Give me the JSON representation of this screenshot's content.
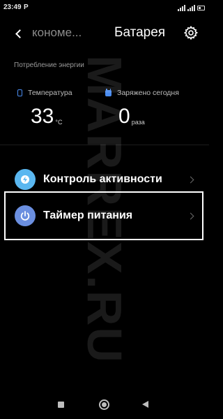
{
  "status_bar": {
    "time": "23:49",
    "carrier_icon_text": "P",
    "icons": [
      "signal-icon",
      "signal-icon",
      "battery-icon"
    ]
  },
  "header": {
    "previous_screen": "кономе...",
    "title": "Батарея"
  },
  "section": {
    "label": "Потребление энергии"
  },
  "stats": {
    "temperature": {
      "label": "Температура",
      "value": "33",
      "unit": "°C"
    },
    "charged_today": {
      "label": "Заряжено сегодня",
      "value": "0",
      "unit": "раза"
    }
  },
  "list": [
    {
      "label": "Контроль активности",
      "icon": "bolt-icon",
      "icon_color": "#5ab7f0"
    },
    {
      "label": "Таймер питания",
      "icon": "power-icon",
      "icon_color": "#6b8fe0"
    }
  ],
  "watermark": "MARREX.RU",
  "colors": {
    "accent": "#4a8cf0",
    "background": "#000000",
    "highlight_border": "#ffffff"
  }
}
